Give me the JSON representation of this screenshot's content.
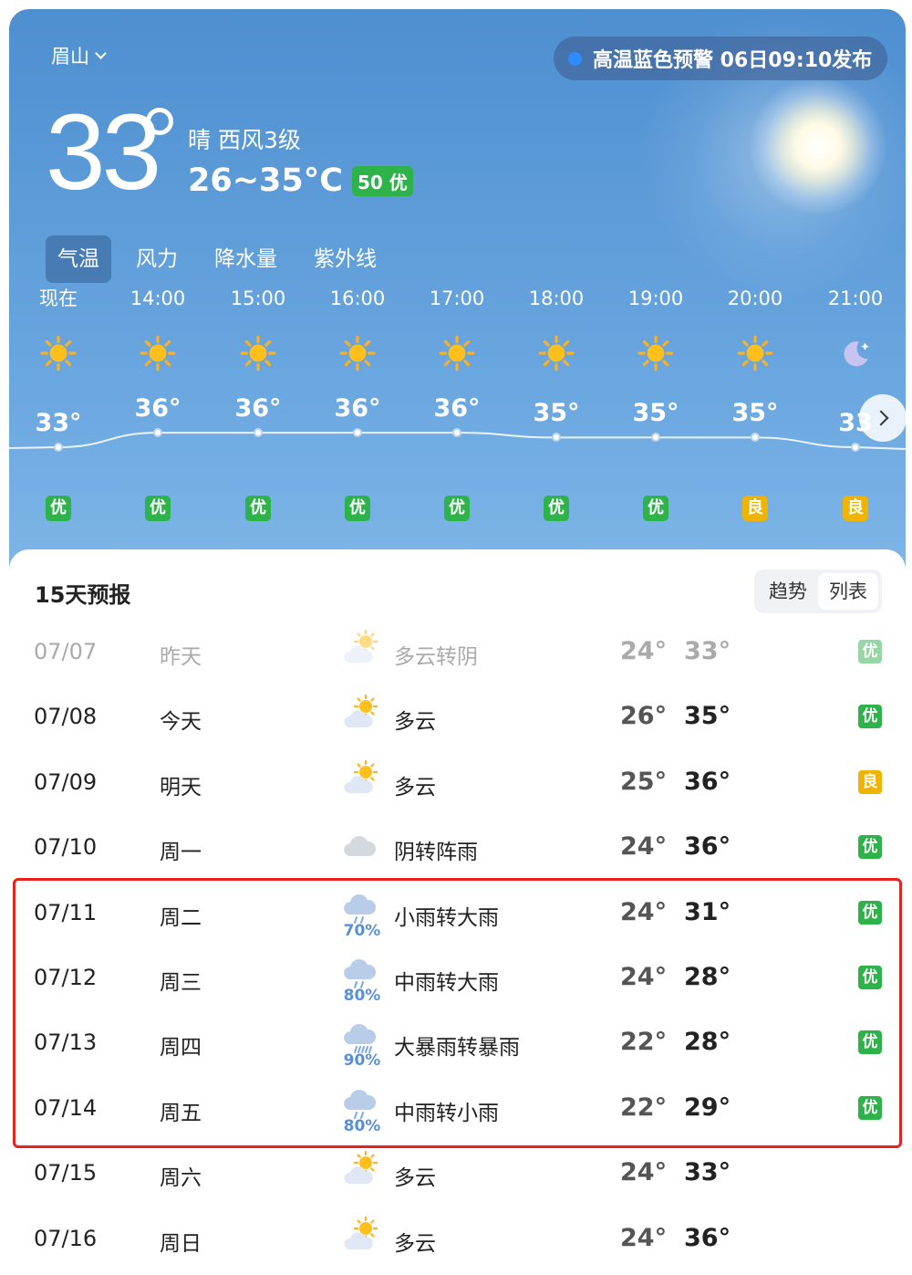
{
  "header": {
    "city": "眉山",
    "alert": "高温蓝色预警  06日09:10发布",
    "current_temp": "33",
    "condition": "晴  西风3级",
    "range": "26~35°C",
    "aqi": "50 优"
  },
  "tabs": [
    "气温",
    "风力",
    "降水量",
    "紫外线"
  ],
  "hourly": [
    {
      "time": "现在",
      "temp": "33°",
      "icon": "sun-icon",
      "aqi": "优"
    },
    {
      "time": "14:00",
      "temp": "36°",
      "icon": "sun-icon",
      "aqi": "优"
    },
    {
      "time": "15:00",
      "temp": "36°",
      "icon": "sun-icon",
      "aqi": "优"
    },
    {
      "time": "16:00",
      "temp": "36°",
      "icon": "sun-icon",
      "aqi": "优"
    },
    {
      "time": "17:00",
      "temp": "36°",
      "icon": "sun-icon",
      "aqi": "优"
    },
    {
      "time": "18:00",
      "temp": "35°",
      "icon": "sun-icon",
      "aqi": "优"
    },
    {
      "time": "19:00",
      "temp": "35°",
      "icon": "sun-icon",
      "aqi": "优"
    },
    {
      "time": "20:00",
      "temp": "35°",
      "icon": "sun-icon",
      "aqi": "良"
    },
    {
      "time": "21:00",
      "temp": "33",
      "icon": "moon-icon",
      "aqi": "良"
    }
  ],
  "forecast": {
    "title": "15天预报",
    "view_trend": "趋势",
    "view_list": "列表",
    "rows": [
      {
        "date": "07/07",
        "day": "昨天",
        "icon": "partly-cloudy-icon",
        "prob": "",
        "text": "多云转阴",
        "lo": "24°",
        "hi": "33°",
        "aqi": "优",
        "past": true
      },
      {
        "date": "07/08",
        "day": "今天",
        "icon": "partly-cloudy-icon",
        "prob": "",
        "text": "多云",
        "lo": "26°",
        "hi": "35°",
        "aqi": "优"
      },
      {
        "date": "07/09",
        "day": "明天",
        "icon": "partly-cloudy-icon",
        "prob": "",
        "text": "多云",
        "lo": "25°",
        "hi": "36°",
        "aqi": "良"
      },
      {
        "date": "07/10",
        "day": "周一",
        "icon": "cloudy-icon",
        "prob": "",
        "text": "阴转阵雨",
        "lo": "24°",
        "hi": "36°",
        "aqi": "优"
      },
      {
        "date": "07/11",
        "day": "周二",
        "icon": "rain-icon",
        "prob": "70%",
        "text": "小雨转大雨",
        "lo": "24°",
        "hi": "31°",
        "aqi": "优"
      },
      {
        "date": "07/12",
        "day": "周三",
        "icon": "rain-icon",
        "prob": "80%",
        "text": "中雨转大雨",
        "lo": "24°",
        "hi": "28°",
        "aqi": "优"
      },
      {
        "date": "07/13",
        "day": "周四",
        "icon": "heavy-rain-icon",
        "prob": "90%",
        "text": "大暴雨转暴雨",
        "lo": "22°",
        "hi": "28°",
        "aqi": "优"
      },
      {
        "date": "07/14",
        "day": "周五",
        "icon": "rain-icon",
        "prob": "80%",
        "text": "中雨转小雨",
        "lo": "22°",
        "hi": "29°",
        "aqi": "优"
      },
      {
        "date": "07/15",
        "day": "周六",
        "icon": "partly-cloudy-icon",
        "prob": "",
        "text": "多云",
        "lo": "24°",
        "hi": "33°",
        "aqi": ""
      },
      {
        "date": "07/16",
        "day": "周日",
        "icon": "partly-cloudy-icon",
        "prob": "",
        "text": "多云",
        "lo": "24°",
        "hi": "36°",
        "aqi": ""
      }
    ]
  },
  "colors": {
    "good": "#2db34a",
    "fair": "#f0b400",
    "highlight": "#e8211d",
    "rain_prob": "#5a8fd8"
  }
}
